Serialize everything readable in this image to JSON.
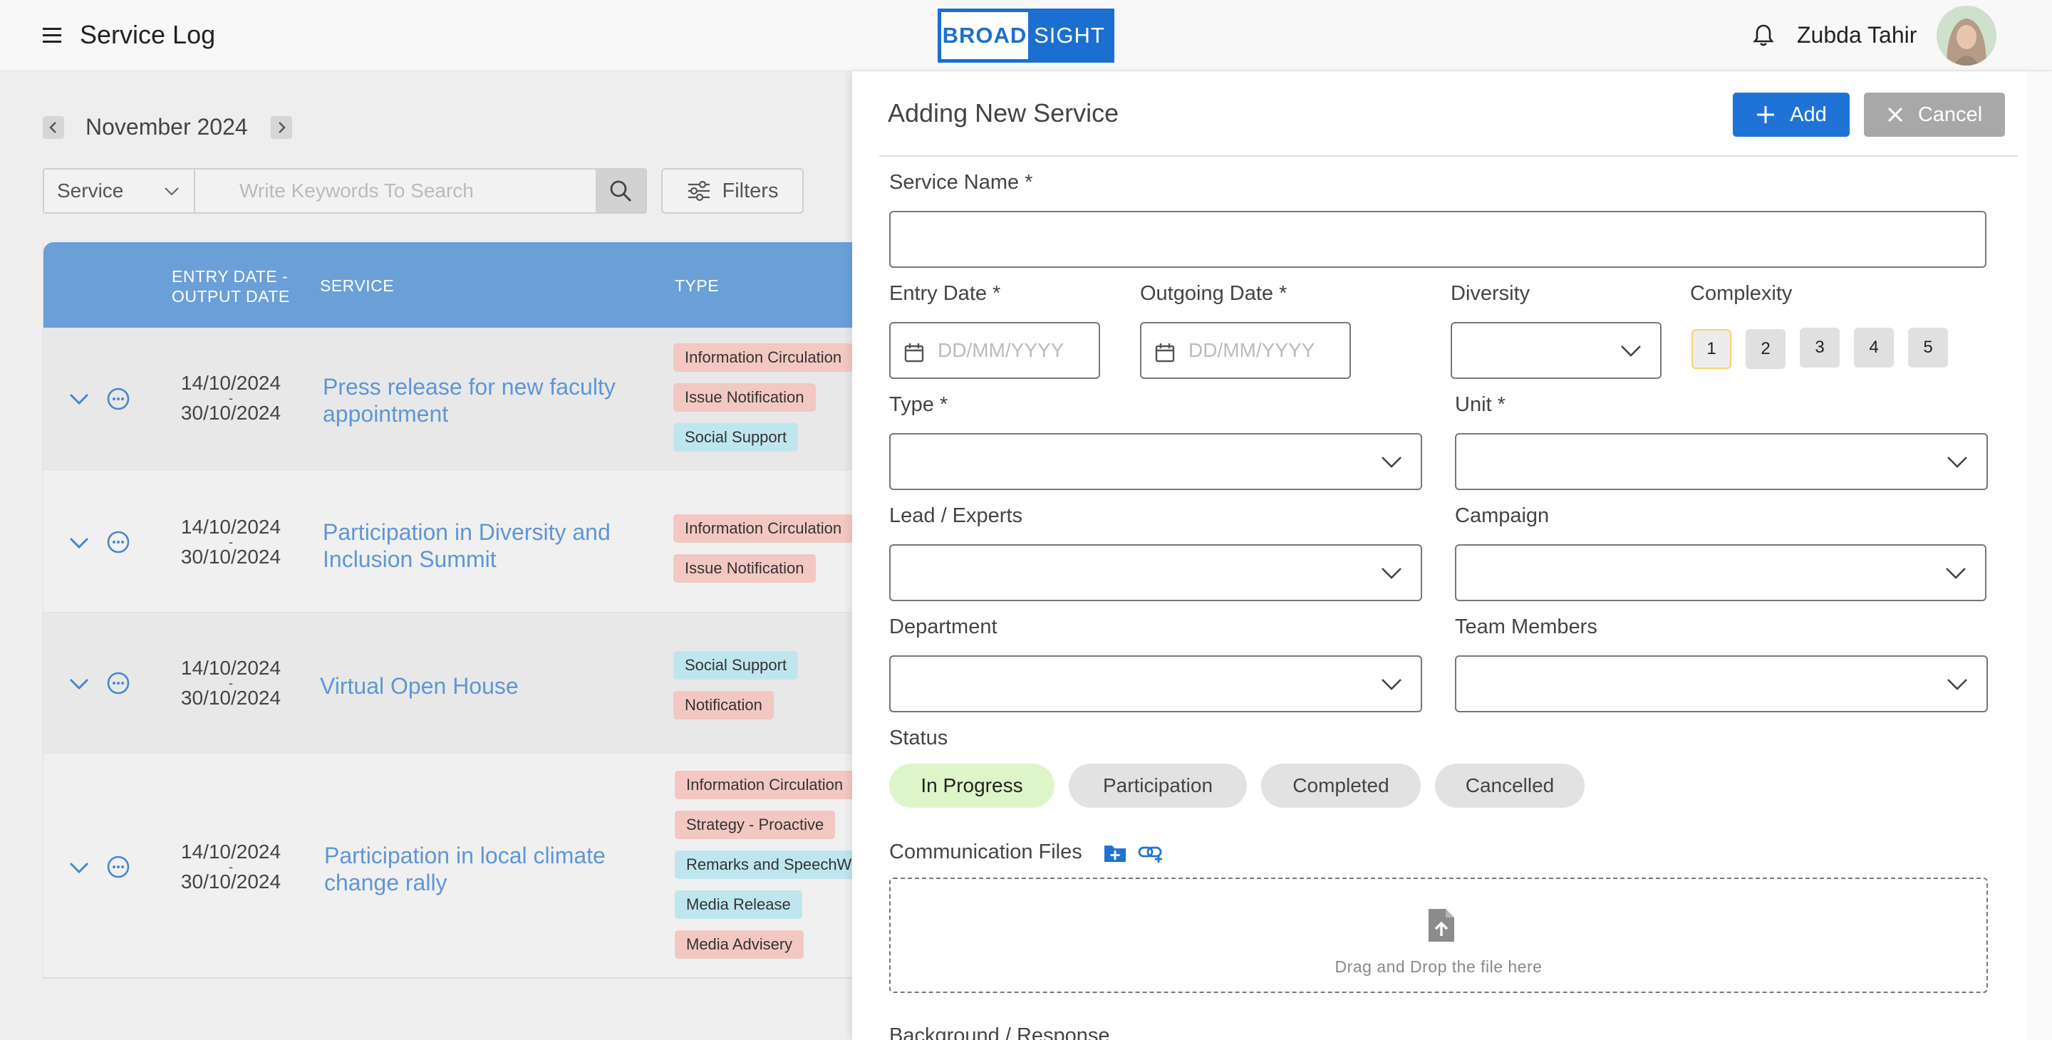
{
  "header": {
    "app_title": "Service Log",
    "logo_left": "BROAD",
    "logo_right": "SIGHT",
    "user_name": "Zubda Tahir"
  },
  "list": {
    "month": "November 2024",
    "search_select": "Service",
    "search_placeholder": "Write Keywords To Search",
    "filters_label": "Filters",
    "columns": {
      "dates_line1": "ENTRY DATE -",
      "dates_line2": "OUTPUT DATE",
      "service": "SERVICE",
      "type": "TYPE"
    },
    "rows": [
      {
        "entry": "14/10/2024",
        "sep": "-",
        "output": "30/10/2024",
        "title": "Press release for new faculty appointment",
        "tags": [
          "Information Circulation",
          "Issue Notification",
          "Social Support"
        ]
      },
      {
        "entry": "14/10/2024",
        "sep": "-",
        "output": "30/10/2024",
        "title": "Participation in Diversity and Inclusion Summit",
        "tags": [
          "Information Circulation",
          "Issue Notification"
        ]
      },
      {
        "entry": "14/10/2024",
        "sep": "-",
        "output": "30/10/2024",
        "title": "Virtual Open House",
        "tags": [
          "Social Support",
          "Notification"
        ]
      },
      {
        "entry": "14/10/2024",
        "sep": "-",
        "output": "30/10/2024",
        "title": "Participation in local climate change rally",
        "tags": [
          "Information Circulation",
          "Strategy - Proactive",
          "Remarks and SpeechW",
          "Media Release",
          "Media Advisery"
        ]
      }
    ]
  },
  "panel": {
    "title": "Adding New Service",
    "add_label": "Add",
    "cancel_label": "Cancel",
    "labels": {
      "service_name": "Service Name *",
      "entry_date": "Entry Date *",
      "outgoing_date": "Outgoing Date *",
      "diversity": "Diversity",
      "complexity": "Complexity",
      "type": "Type *",
      "unit": "Unit *",
      "lead": "Lead / Experts",
      "campaign": "Campaign",
      "department": "Department",
      "team": "Team Members",
      "status": "Status",
      "files": "Communication Files",
      "background": "Background / Response"
    },
    "date_placeholder": "DD/MM/YYYY",
    "complexity": [
      "1",
      "2",
      "3",
      "4",
      "5"
    ],
    "complexity_selected": "1",
    "statuses": [
      "In Progress",
      "Participation",
      "Completed",
      "Cancelled"
    ],
    "status_selected": "In Progress",
    "drop_text": "Drag and Drop the file here"
  },
  "colors": {
    "accent": "#1f73d6",
    "header_row": "#6a9fd8",
    "link": "#5f96d5",
    "tag_red": "#f3c8c2",
    "tag_blue": "#bfe6ef",
    "status_active": "#def5c9"
  }
}
